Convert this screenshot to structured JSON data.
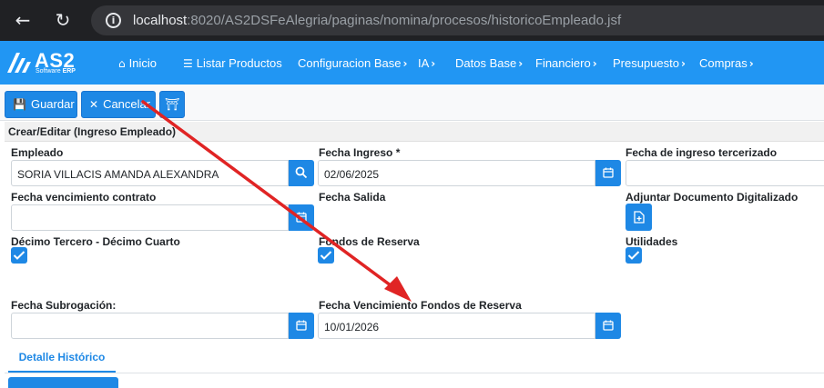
{
  "browser": {
    "back_icon": "arrow-left-icon",
    "reload_icon": "reload-icon",
    "url_host": "localhost",
    "url_rest": ":8020/AS2DSFeAlegria/paginas/nomina/procesos/historicoEmpleado.jsf"
  },
  "logo": {
    "text": "AS2",
    "sub_prefix": "Software ",
    "sub_bold": "ERP"
  },
  "nav": {
    "inicio": "Inicio",
    "listar_productos": "Listar Productos",
    "configuracion_base": "Configuracion Base",
    "ia": "IA",
    "datos_base": "Datos Base",
    "financiero": "Financiero",
    "presupuesto": "Presupuesto",
    "compras": "Compras"
  },
  "toolbar": {
    "guardar": "Guardar",
    "cancelar": "Cancelar"
  },
  "form": {
    "title": "Crear/Editar (Ingreso Empleado)",
    "empleado_label": "Empleado",
    "empleado_value": "SORIA VILLACIS AMANDA ALEXANDRA",
    "fecha_ingreso_label": "Fecha Ingreso *",
    "fecha_ingreso_value": "02/06/2025",
    "fecha_tercerizado_label": "Fecha de ingreso tercerizado",
    "fecha_tercerizado_value": "",
    "fecha_vencimiento_label": "Fecha vencimiento contrato",
    "fecha_vencimiento_value": "",
    "fecha_salida_label": "Fecha Salida",
    "adjuntar_label": "Adjuntar Documento Digitalizado",
    "decimo_label": "Décimo Tercero - Décimo Cuarto",
    "decimo_checked": true,
    "fondos_label": "Fondos de Reserva",
    "fondos_checked": true,
    "utilidades_label": "Utilidades",
    "utilidades_checked": true,
    "fecha_subrogacion_label": "Fecha Subrogación:",
    "fecha_subrogacion_value": "",
    "fecha_venc_fondos_label": "Fecha Vencimiento Fondos de Reserva",
    "fecha_venc_fondos_value": "10/01/2026"
  },
  "tabs": {
    "detalle_historico": "Detalle Histórico"
  },
  "colors": {
    "primary": "#1e88e5",
    "nav_bg": "#2196f3",
    "annotation_arrow": "#e02424"
  }
}
